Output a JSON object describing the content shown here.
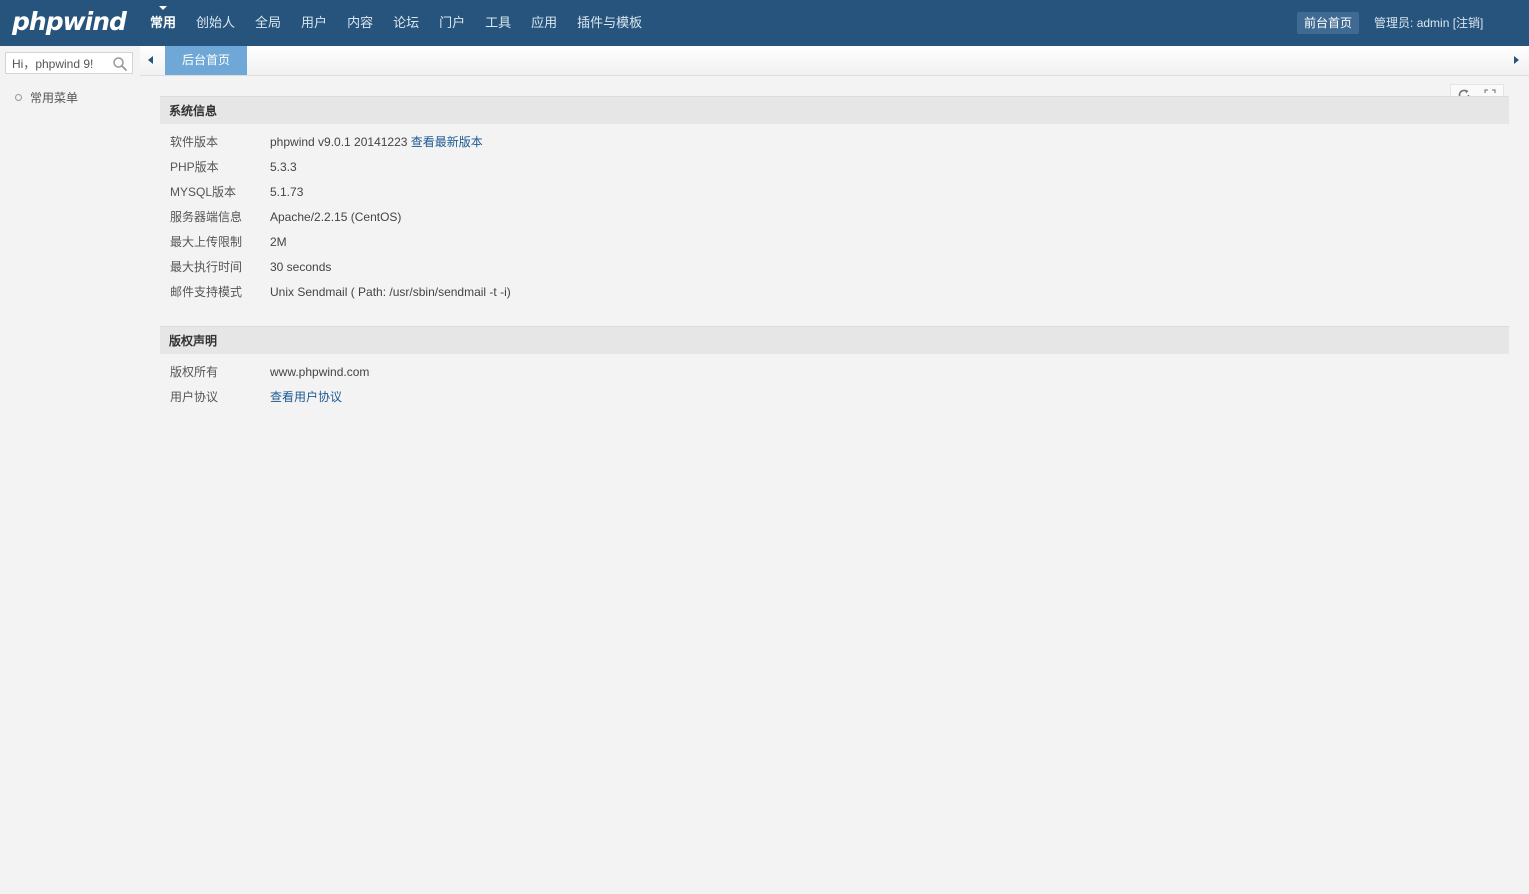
{
  "header": {
    "logo": "phpwind",
    "nav": [
      {
        "label": "常用",
        "active": true
      },
      {
        "label": "创始人"
      },
      {
        "label": "全局"
      },
      {
        "label": "用户"
      },
      {
        "label": "内容"
      },
      {
        "label": "论坛"
      },
      {
        "label": "门户"
      },
      {
        "label": "工具"
      },
      {
        "label": "应用"
      },
      {
        "label": "插件与模板"
      }
    ],
    "front_button": "前台首页",
    "admin_label": "管理员:",
    "admin_name": "admin",
    "logout": "[注销]"
  },
  "sidebar": {
    "search_value": "Hi，phpwind 9!",
    "menu_item": "常用菜单"
  },
  "tabs": {
    "active": "后台首页"
  },
  "system_info": {
    "title": "系统信息",
    "rows": [
      {
        "label": "软件版本",
        "value": "phpwind v9.0.1 20141223",
        "link": "查看最新版本"
      },
      {
        "label": "PHP版本",
        "value": "5.3.3"
      },
      {
        "label": "MYSQL版本",
        "value": "5.1.73"
      },
      {
        "label": "服务器端信息",
        "value": "Apache/2.2.15 (CentOS)"
      },
      {
        "label": "最大上传限制",
        "value": "2M"
      },
      {
        "label": "最大执行时间",
        "value": "30 seconds"
      },
      {
        "label": "邮件支持模式",
        "value": "Unix Sendmail ( Path: /usr/sbin/sendmail -t -i)"
      }
    ]
  },
  "copyright": {
    "title": "版权声明",
    "rows": [
      {
        "label": "版权所有",
        "value": "www.phpwind.com"
      },
      {
        "label": "用户协议",
        "link": "查看用户协议"
      }
    ]
  },
  "icons": {
    "search": "search-icon",
    "refresh": "refresh-icon",
    "fullscreen": "fullscreen-icon"
  },
  "colors": {
    "header_bg": "#26547c",
    "tab_active": "#6fa8d6",
    "link": "#1d5a93"
  }
}
